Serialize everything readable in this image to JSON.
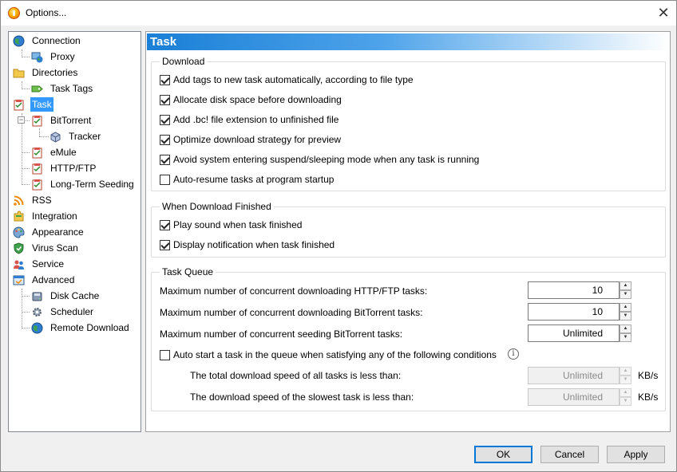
{
  "window": {
    "title": "Options...",
    "close_glyph": "✕"
  },
  "tree": {
    "items": [
      {
        "label": "Connection",
        "icon": "globe-icon"
      },
      {
        "label": "Proxy",
        "icon": "network-icon"
      },
      {
        "label": "Directories",
        "icon": "folder-icon"
      },
      {
        "label": "Task Tags",
        "icon": "tag-icon"
      },
      {
        "label": "Task",
        "icon": "task-icon",
        "selected": true
      },
      {
        "label": "BitTorrent",
        "icon": "task-icon"
      },
      {
        "label": "Tracker",
        "icon": "box-icon"
      },
      {
        "label": "eMule",
        "icon": "task-icon"
      },
      {
        "label": "HTTP/FTP",
        "icon": "task-icon"
      },
      {
        "label": "Long-Term Seeding",
        "icon": "task-icon"
      },
      {
        "label": "RSS",
        "icon": "rss-icon"
      },
      {
        "label": "Integration",
        "icon": "puzzle-icon"
      },
      {
        "label": "Appearance",
        "icon": "palette-icon"
      },
      {
        "label": "Virus Scan",
        "icon": "shield-icon"
      },
      {
        "label": "Service",
        "icon": "users-icon"
      },
      {
        "label": "Advanced",
        "icon": "advanced-icon"
      },
      {
        "label": "Disk Cache",
        "icon": "disk-icon"
      },
      {
        "label": "Scheduler",
        "icon": "gear-icon"
      },
      {
        "label": "Remote Download",
        "icon": "globe-icon"
      }
    ]
  },
  "panel": {
    "title": "Task",
    "download": {
      "title": "Download",
      "options": [
        {
          "label": "Add tags to new task automatically, according to file type",
          "checked": true
        },
        {
          "label": "Allocate disk space before downloading",
          "checked": true
        },
        {
          "label": "Add .bc! file extension to unfinished file",
          "checked": true
        },
        {
          "label": "Optimize download strategy for preview",
          "checked": true
        },
        {
          "label": "Avoid system entering suspend/sleeping mode when any task is running",
          "checked": true
        },
        {
          "label": "Auto-resume tasks at program startup",
          "checked": false
        }
      ]
    },
    "finished": {
      "title": "When Download Finished",
      "options": [
        {
          "label": "Play sound when task finished",
          "checked": true
        },
        {
          "label": "Display notification when task finished",
          "checked": true
        }
      ]
    },
    "queue": {
      "title": "Task Queue",
      "http_label": "Maximum number of concurrent downloading HTTP/FTP tasks:",
      "http_value": "10",
      "bt_label": "Maximum number of concurrent downloading BitTorrent tasks:",
      "bt_value": "10",
      "seed_label": "Maximum number of concurrent seeding BitTorrent tasks:",
      "seed_value": "Unlimited",
      "auto_start_label": "Auto start a task in the queue when satisfying any of the following conditions",
      "auto_start_checked": false,
      "total_speed_label": "The total download speed of all tasks is less than:",
      "total_speed_value": "Unlimited",
      "slowest_speed_label": "The download speed of the slowest task is less than:",
      "slowest_speed_value": "Unlimited",
      "unit": "KB/s",
      "info_glyph": "i"
    }
  },
  "buttons": {
    "ok": "OK",
    "cancel": "Cancel",
    "apply": "Apply"
  }
}
